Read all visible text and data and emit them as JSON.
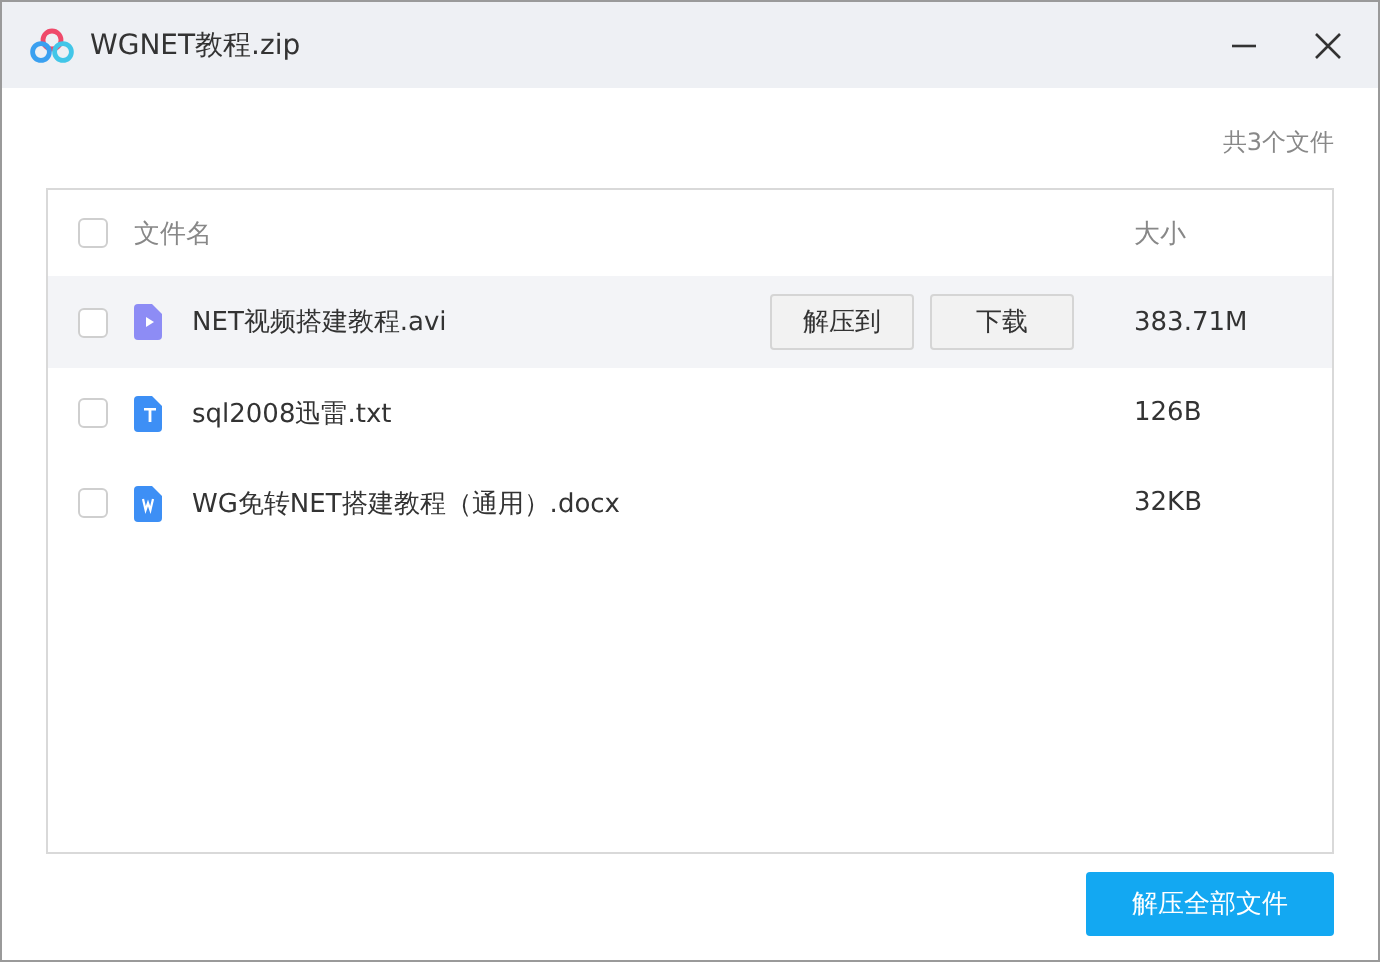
{
  "window": {
    "title": "WGNET教程.zip"
  },
  "file_count": "共3个文件",
  "table": {
    "columns": [
      "文件名",
      "大小"
    ],
    "select_all": {
      "checked": false
    },
    "rows": [
      {
        "kind": "video",
        "name": "NET视频搭建教程.avi",
        "size": "383.71M",
        "checked": false,
        "highlighted": true,
        "actions": [
          "解压到",
          "下载"
        ]
      },
      {
        "kind": "text",
        "name": "sql2008迅雷.txt",
        "size": "126B",
        "checked": false,
        "highlighted": false
      },
      {
        "kind": "word",
        "name": "WG免转NET搭建教程（通用）.docx",
        "size": "32KB",
        "checked": false,
        "highlighted": false
      }
    ]
  },
  "primary_button": "解压全部文件"
}
